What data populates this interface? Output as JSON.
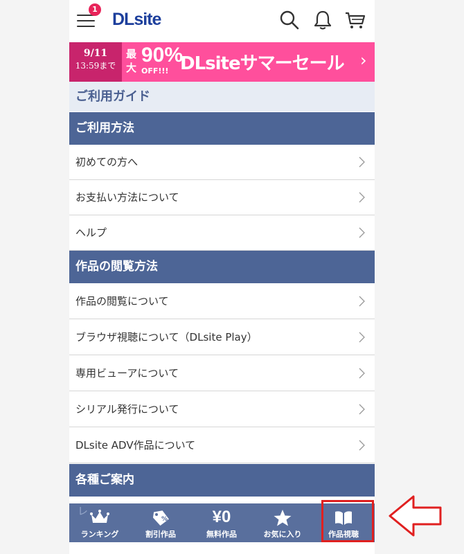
{
  "header": {
    "notification_count": "1",
    "logo": "DLsite",
    "icons": [
      "menu-icon",
      "search-icon",
      "bell-icon",
      "cart-icon"
    ]
  },
  "banner": {
    "date": "9/11",
    "time": "13:59まで",
    "pre_top": "最",
    "pre_bottom": "大",
    "percent": "90%",
    "off": "OFF!!!",
    "title": "DLsiteサマーセール"
  },
  "guide_title": "ご利用ガイド",
  "sections": [
    {
      "heading": "ご利用方法",
      "items": [
        "初めての方へ",
        "お支払い方法について",
        "ヘルプ"
      ]
    },
    {
      "heading": "作品の閲覧方法",
      "items": [
        "作品の閲覧について",
        "ブラウザ視聴について（DLsite Play）",
        "専用ビューアについて",
        "シリアル発行について",
        "DLsite ADV作品について"
      ]
    },
    {
      "heading": "各種ご案内",
      "items": []
    }
  ],
  "bottom_nav": {
    "hidden_row_text": "レ",
    "items": [
      {
        "label": "ランキング",
        "icon": "crown-icon"
      },
      {
        "label": "割引作品",
        "icon": "discount-tag-icon"
      },
      {
        "label": "無料作品",
        "icon": "yen-icon",
        "glyph": "¥0"
      },
      {
        "label": "お気に入り",
        "icon": "star-icon"
      },
      {
        "label": "作品視聴",
        "icon": "book-icon"
      }
    ]
  },
  "colors": {
    "accent_navy": "#4d6596",
    "banner_pink": "#ff4f9c",
    "badge_red": "#e8245a",
    "highlight_red": "#e02020"
  }
}
